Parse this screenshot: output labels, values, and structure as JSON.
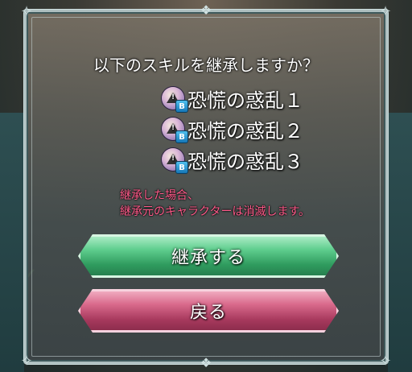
{
  "dialog": {
    "question": "以下のスキルを継承しますか？",
    "skills": [
      {
        "name": "恐慌の惑乱１",
        "slot": "B",
        "icon": "panic-ploy-skill-icon"
      },
      {
        "name": "恐慌の惑乱２",
        "slot": "B",
        "icon": "panic-ploy-skill-icon"
      },
      {
        "name": "恐慌の惑乱３",
        "slot": "B",
        "icon": "panic-ploy-skill-icon"
      }
    ],
    "warning_line1": "継承した場合、",
    "warning_line2": "継承元のキャラクターは消滅します。",
    "confirm_label": "継承する",
    "back_label": "戻る"
  },
  "colors": {
    "warning_text": "#ff5a8a",
    "confirm_button": "#3fae6d",
    "back_button": "#b8476b",
    "frame": "#aebfc0"
  }
}
